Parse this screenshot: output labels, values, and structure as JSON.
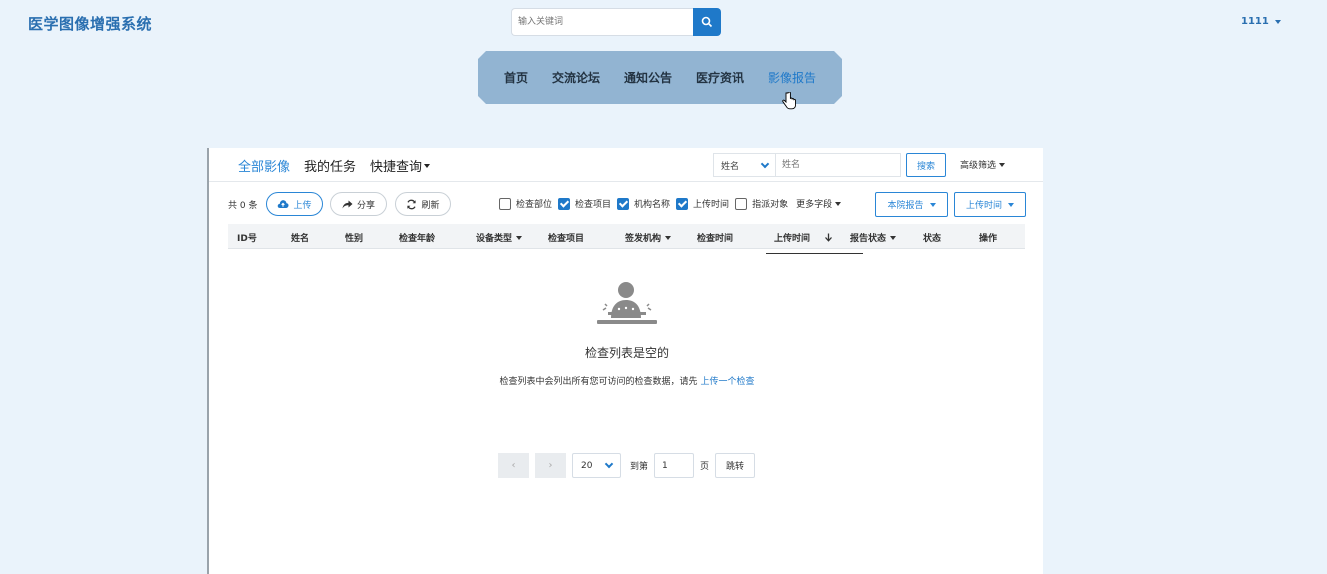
{
  "header": {
    "app_title": "医学图像增强系统",
    "search_placeholder": "输入关键词",
    "user_name": "1111"
  },
  "nav": {
    "items": [
      "首页",
      "交流论坛",
      "通知公告",
      "医疗资讯",
      "影像报告"
    ],
    "active_index": 4
  },
  "tabs": {
    "all": "全部影像",
    "mine": "我的任务",
    "quick": "快捷查询"
  },
  "filter": {
    "field_selected": "姓名",
    "input_placeholder": "姓名",
    "search_label": "搜索",
    "advanced_label": "高级筛选"
  },
  "toolbar": {
    "count_text": "共 0 条",
    "upload_label": "上传",
    "share_label": "分享",
    "refresh_label": "刷新",
    "checks": [
      {
        "label": "检查部位",
        "checked": false
      },
      {
        "label": "检查项目",
        "checked": true
      },
      {
        "label": "机构名称",
        "checked": true
      },
      {
        "label": "上传时间",
        "checked": false
      },
      {
        "label": "指派对象",
        "checked": false
      }
    ],
    "more_fields_label": "更多字段",
    "report_dropdown_label": "本院报告",
    "time_dropdown_label": "上传时间"
  },
  "table": {
    "columns": [
      "ID号",
      "姓名",
      "性别",
      "检查年龄",
      "设备类型",
      "检查项目",
      "签发机构",
      "检查时间",
      "上传时间",
      "报告状态",
      "状态",
      "操作"
    ]
  },
  "empty_state": {
    "title": "检查列表是空的",
    "desc_prefix": "检查列表中会列出所有您可访问的检查数据，请先",
    "desc_link": "上传一个检查"
  },
  "pagination": {
    "prev": "‹",
    "next": "›",
    "page_size": "20",
    "goto_prefix": "到第",
    "current_page": "1",
    "goto_suffix": "页",
    "jump_label": "跳转"
  },
  "colors": {
    "accent": "#1f79c9",
    "nav_bg": "#92b4d2",
    "page_bg": "#eaf3fb"
  }
}
